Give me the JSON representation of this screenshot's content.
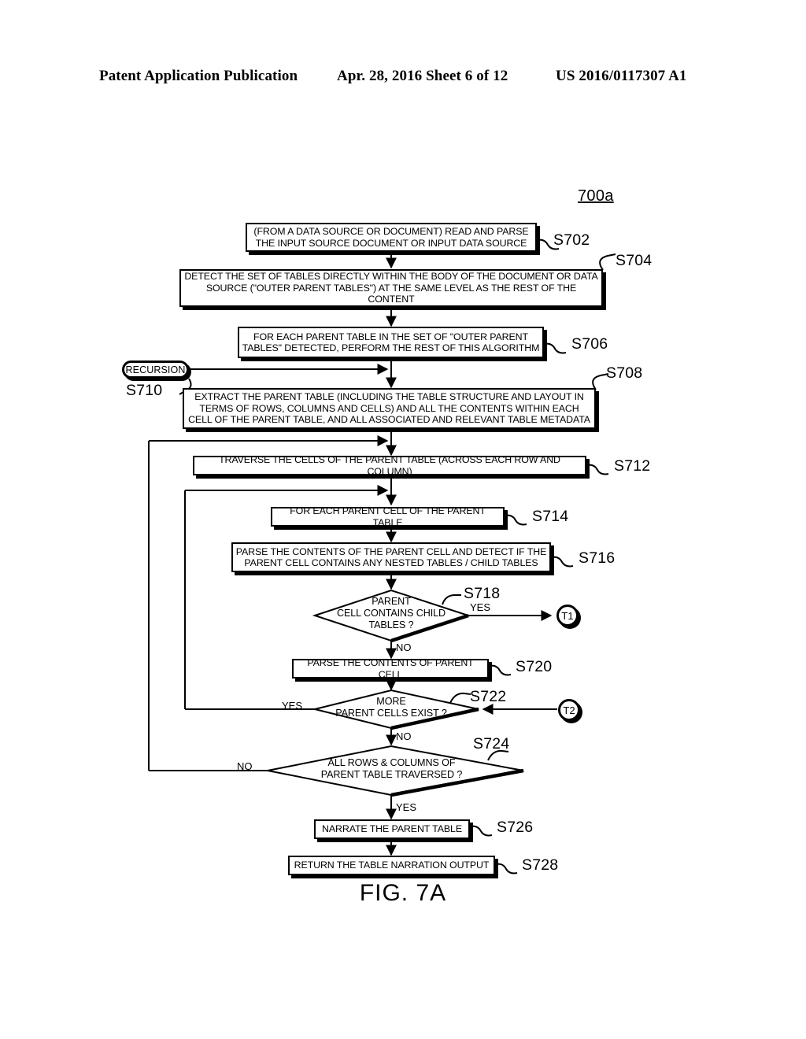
{
  "header": {
    "publication": "Patent Application Publication",
    "date_sheet": "Apr. 28, 2016  Sheet 6 of 12",
    "patent_number": "US 2016/0117307 A1"
  },
  "figure": {
    "diagram_id": "700a",
    "caption": "FIG. 7A"
  },
  "nodes": {
    "s702": {
      "ref": "S702",
      "text": "(FROM A DATA SOURCE OR DOCUMENT) READ AND PARSE THE INPUT SOURCE DOCUMENT OR INPUT DATA SOURCE",
      "shape": "process"
    },
    "s704": {
      "ref": "S704",
      "text": "DETECT THE SET OF TABLES DIRECTLY WITHIN THE BODY OF THE DOCUMENT OR DATA SOURCE (\"OUTER PARENT TABLES\") AT THE SAME LEVEL AS THE REST OF THE CONTENT",
      "shape": "process"
    },
    "s706": {
      "ref": "S706",
      "text": "FOR EACH PARENT TABLE IN THE SET OF \"OUTER PARENT TABLES\" DETECTED, PERFORM THE REST OF THIS ALGORITHM",
      "shape": "process"
    },
    "s710": {
      "ref": "S710",
      "text": "RECURSION",
      "shape": "terminator"
    },
    "s708": {
      "ref": "S708",
      "text": "EXTRACT THE PARENT TABLE (INCLUDING THE TABLE STRUCTURE AND LAYOUT IN TERMS OF ROWS, COLUMNS AND CELLS) AND ALL THE CONTENTS WITHIN EACH CELL OF THE PARENT TABLE, AND ALL ASSOCIATED AND RELEVANT TABLE METADATA",
      "shape": "process"
    },
    "s712": {
      "ref": "S712",
      "text": "TRAVERSE THE CELLS OF THE PARENT TABLE (ACROSS EACH ROW AND COLUMN)",
      "shape": "process"
    },
    "s714": {
      "ref": "S714",
      "text": "FOR EACH PARENT CELL OF THE PARENT TABLE",
      "shape": "process"
    },
    "s716": {
      "ref": "S716",
      "text": "PARSE THE CONTENTS OF THE PARENT CELL AND DETECT IF THE PARENT CELL CONTAINS ANY NESTED TABLES / CHILD TABLES",
      "shape": "process"
    },
    "s718": {
      "ref": "S718",
      "text": "PARENT\nCELL CONTAINS CHILD\nTABLES ?",
      "shape": "decision",
      "yes_label": "YES",
      "no_label": "NO"
    },
    "s720": {
      "ref": "S720",
      "text": "PARSE THE CONTENTS OF PARENT CELL",
      "shape": "process"
    },
    "s722": {
      "ref": "S722",
      "text": "MORE\nPARENT CELLS EXIST ?",
      "shape": "decision",
      "yes_label": "YES",
      "no_label": "NO"
    },
    "s724": {
      "ref": "S724",
      "text": "ALL ROWS & COLUMNS OF\nPARENT TABLE TRAVERSED ?",
      "shape": "decision",
      "yes_label": "YES",
      "no_label": "NO"
    },
    "s726": {
      "ref": "S726",
      "text": "NARRATE THE PARENT TABLE",
      "shape": "process"
    },
    "s728": {
      "ref": "S728",
      "text": "RETURN THE TABLE NARRATION OUTPUT",
      "shape": "process"
    }
  },
  "connectors": {
    "t1": "T1",
    "t2": "T2"
  },
  "colors": {
    "ink": "#000000",
    "paper": "#ffffff"
  }
}
